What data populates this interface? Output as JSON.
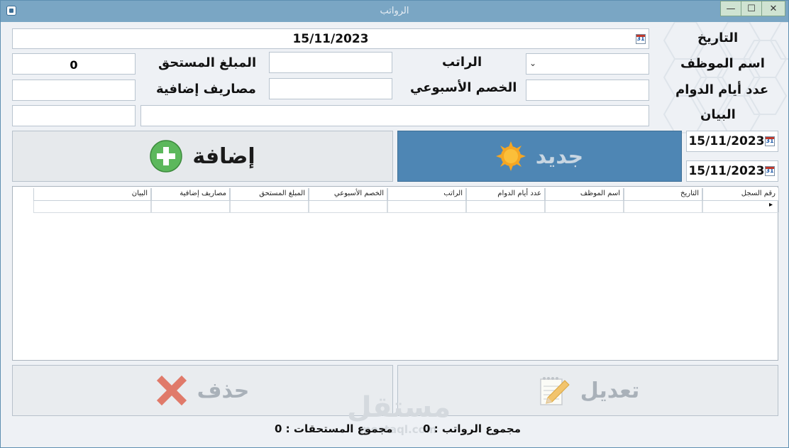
{
  "window": {
    "title": "الرواتب",
    "controls": {
      "minimize": "—",
      "maximize": "☐",
      "close": "✕"
    }
  },
  "form": {
    "date_label": "التاريخ",
    "date_value": "15/11/2023",
    "employee_label": "اسم الموظف",
    "employee_value": "",
    "salary_label": "الراتب",
    "salary_value": "",
    "due_amount_label": "المبلغ المستحق",
    "due_amount_value": "0",
    "work_days_label": "عدد أيام الدوام",
    "work_days_value": "",
    "weekly_deduction_label": "الخصم الأسبوعي",
    "weekly_deduction_value": "",
    "extra_expenses_label": "مصاريف إضافية",
    "extra_expenses_value": "",
    "statement_label": "البيان",
    "statement_value": ""
  },
  "buttons": {
    "add": "إضافة",
    "new": "جديد",
    "delete": "حذف",
    "edit": "تعديل"
  },
  "filter": {
    "date_from": "15/11/2023",
    "date_to": "15/11/2023"
  },
  "calendar_icon_text": "31",
  "table": {
    "columns": [
      "رقم السجل",
      "التاريخ",
      "اسم الموظف",
      "عدد أيام الدوام",
      "الراتب",
      "الخصم الأسبوعي",
      "المبلغ المستحق",
      "مصاريف إضافية",
      "البيان"
    ],
    "rows": [],
    "row_indicator": "▸"
  },
  "totals": {
    "salaries_label": "مجموع الرواتب :",
    "salaries_value": "0",
    "dues_label": "مجموع المستحقات :",
    "dues_value": "0"
  },
  "watermark": {
    "text": "مستقل",
    "domain": "mostaql.com"
  },
  "colors": {
    "titlebar": "#7aa6c4",
    "new_button": "#4e86b4",
    "add_icon": "#5cb85c",
    "delete_icon": "#e07a6a",
    "sun_icon": "#f5a623"
  },
  "icons": {
    "add": "plus-circle-icon",
    "new": "sun-icon",
    "delete": "x-icon",
    "edit": "pencil-notepad-icon",
    "calendar": "calendar-icon"
  }
}
